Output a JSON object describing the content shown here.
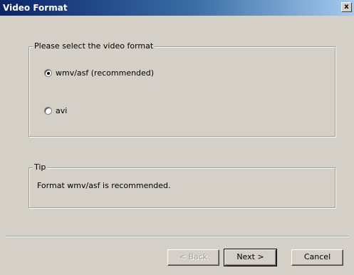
{
  "window": {
    "title": "Video Format",
    "close_label": "x"
  },
  "format_group": {
    "label": "Please select the video format",
    "options": [
      {
        "label": "wmv/asf (recommended)",
        "checked": true
      },
      {
        "label": "avi",
        "checked": false
      }
    ]
  },
  "tip_group": {
    "label": "Tip",
    "text": "Format wmv/asf is recommended."
  },
  "buttons": {
    "back": "< Back",
    "next": "Next >",
    "cancel": "Cancel"
  }
}
